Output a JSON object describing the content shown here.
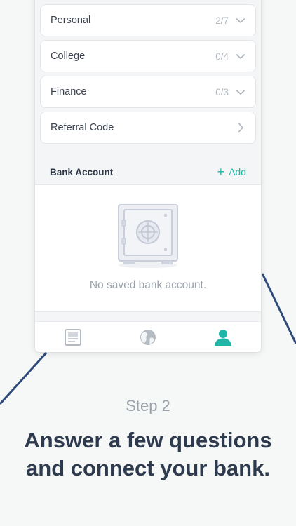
{
  "rows": [
    {
      "label": "Personal",
      "count": "2/7",
      "icon": "chevron-down-icon"
    },
    {
      "label": "College",
      "count": "0/4",
      "icon": "chevron-down-icon"
    },
    {
      "label": "Finance",
      "count": "0/3",
      "icon": "chevron-down-icon"
    },
    {
      "label": "Referral Code",
      "count": "",
      "icon": "chevron-right-icon"
    }
  ],
  "bank": {
    "title": "Bank Account",
    "add_plus": "+",
    "add_label": "Add",
    "empty_text": "No saved bank account.",
    "empty_icon": "safe-icon"
  },
  "tabs": [
    {
      "icon": "document-icon",
      "active": false
    },
    {
      "icon": "globe-icon",
      "active": false
    },
    {
      "icon": "profile-icon",
      "active": true
    }
  ],
  "caption": {
    "step": "Step 2",
    "headline_line1": "Answer a few questions",
    "headline_line2": "and connect your bank."
  },
  "colors": {
    "accent": "#1fb6a8",
    "background": "#f6f7f7",
    "headline": "#2e3a4d",
    "decor_line": "#2f4b7a"
  }
}
